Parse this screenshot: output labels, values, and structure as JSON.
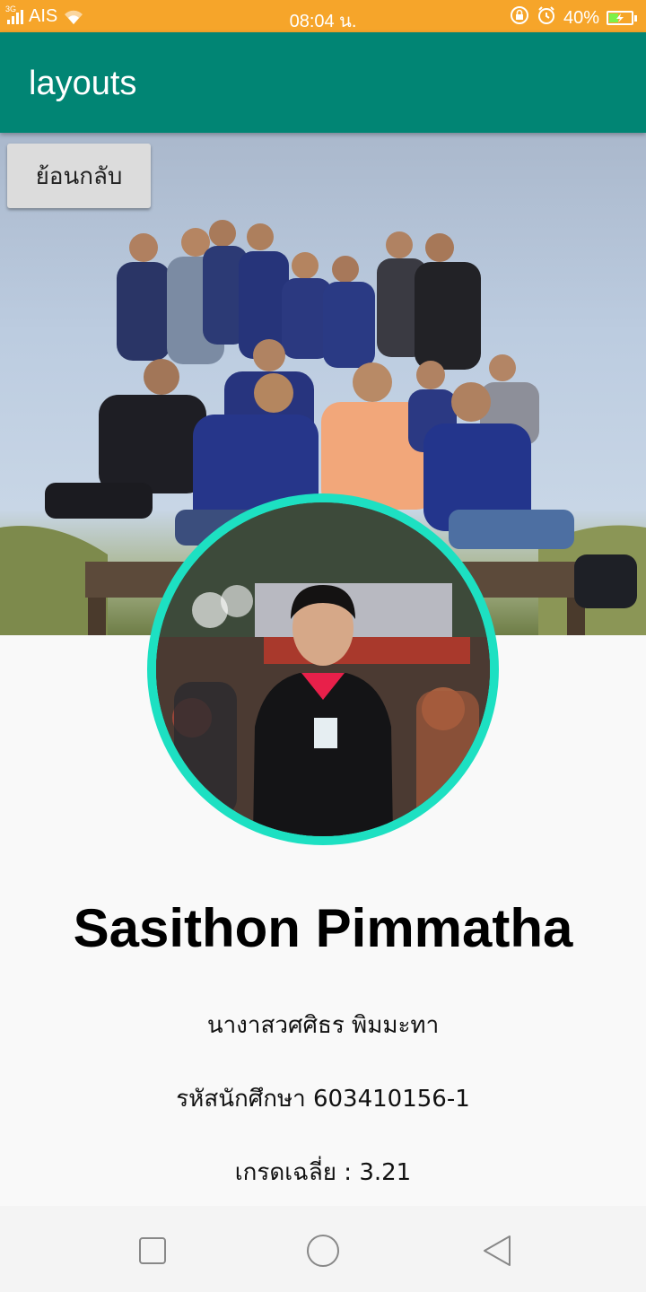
{
  "status_bar": {
    "network_tag": "3G",
    "carrier": "AIS",
    "time": "08:04 น.",
    "battery_percent": "40%",
    "battery_level": 0.4,
    "icons": [
      "signal-icon",
      "wifi-icon",
      "lock-rotation-icon",
      "alarm-icon",
      "battery-charging-icon"
    ]
  },
  "app_bar": {
    "title": "layouts",
    "color": "#018574"
  },
  "back_button": {
    "label": "ย้อนกลับ"
  },
  "profile": {
    "name": "Sasithon Pimmatha",
    "thai_name": "นางาสวศศิธร พิมมะทา",
    "student_id": "รหัสนักศึกษา 603410156-1",
    "gpa": "เกรดเฉลี่ย : 3.21",
    "ring_color": "#1de0c2"
  },
  "nav_bar": {
    "buttons": [
      "recent-apps-button",
      "home-button",
      "back-nav-button"
    ]
  }
}
